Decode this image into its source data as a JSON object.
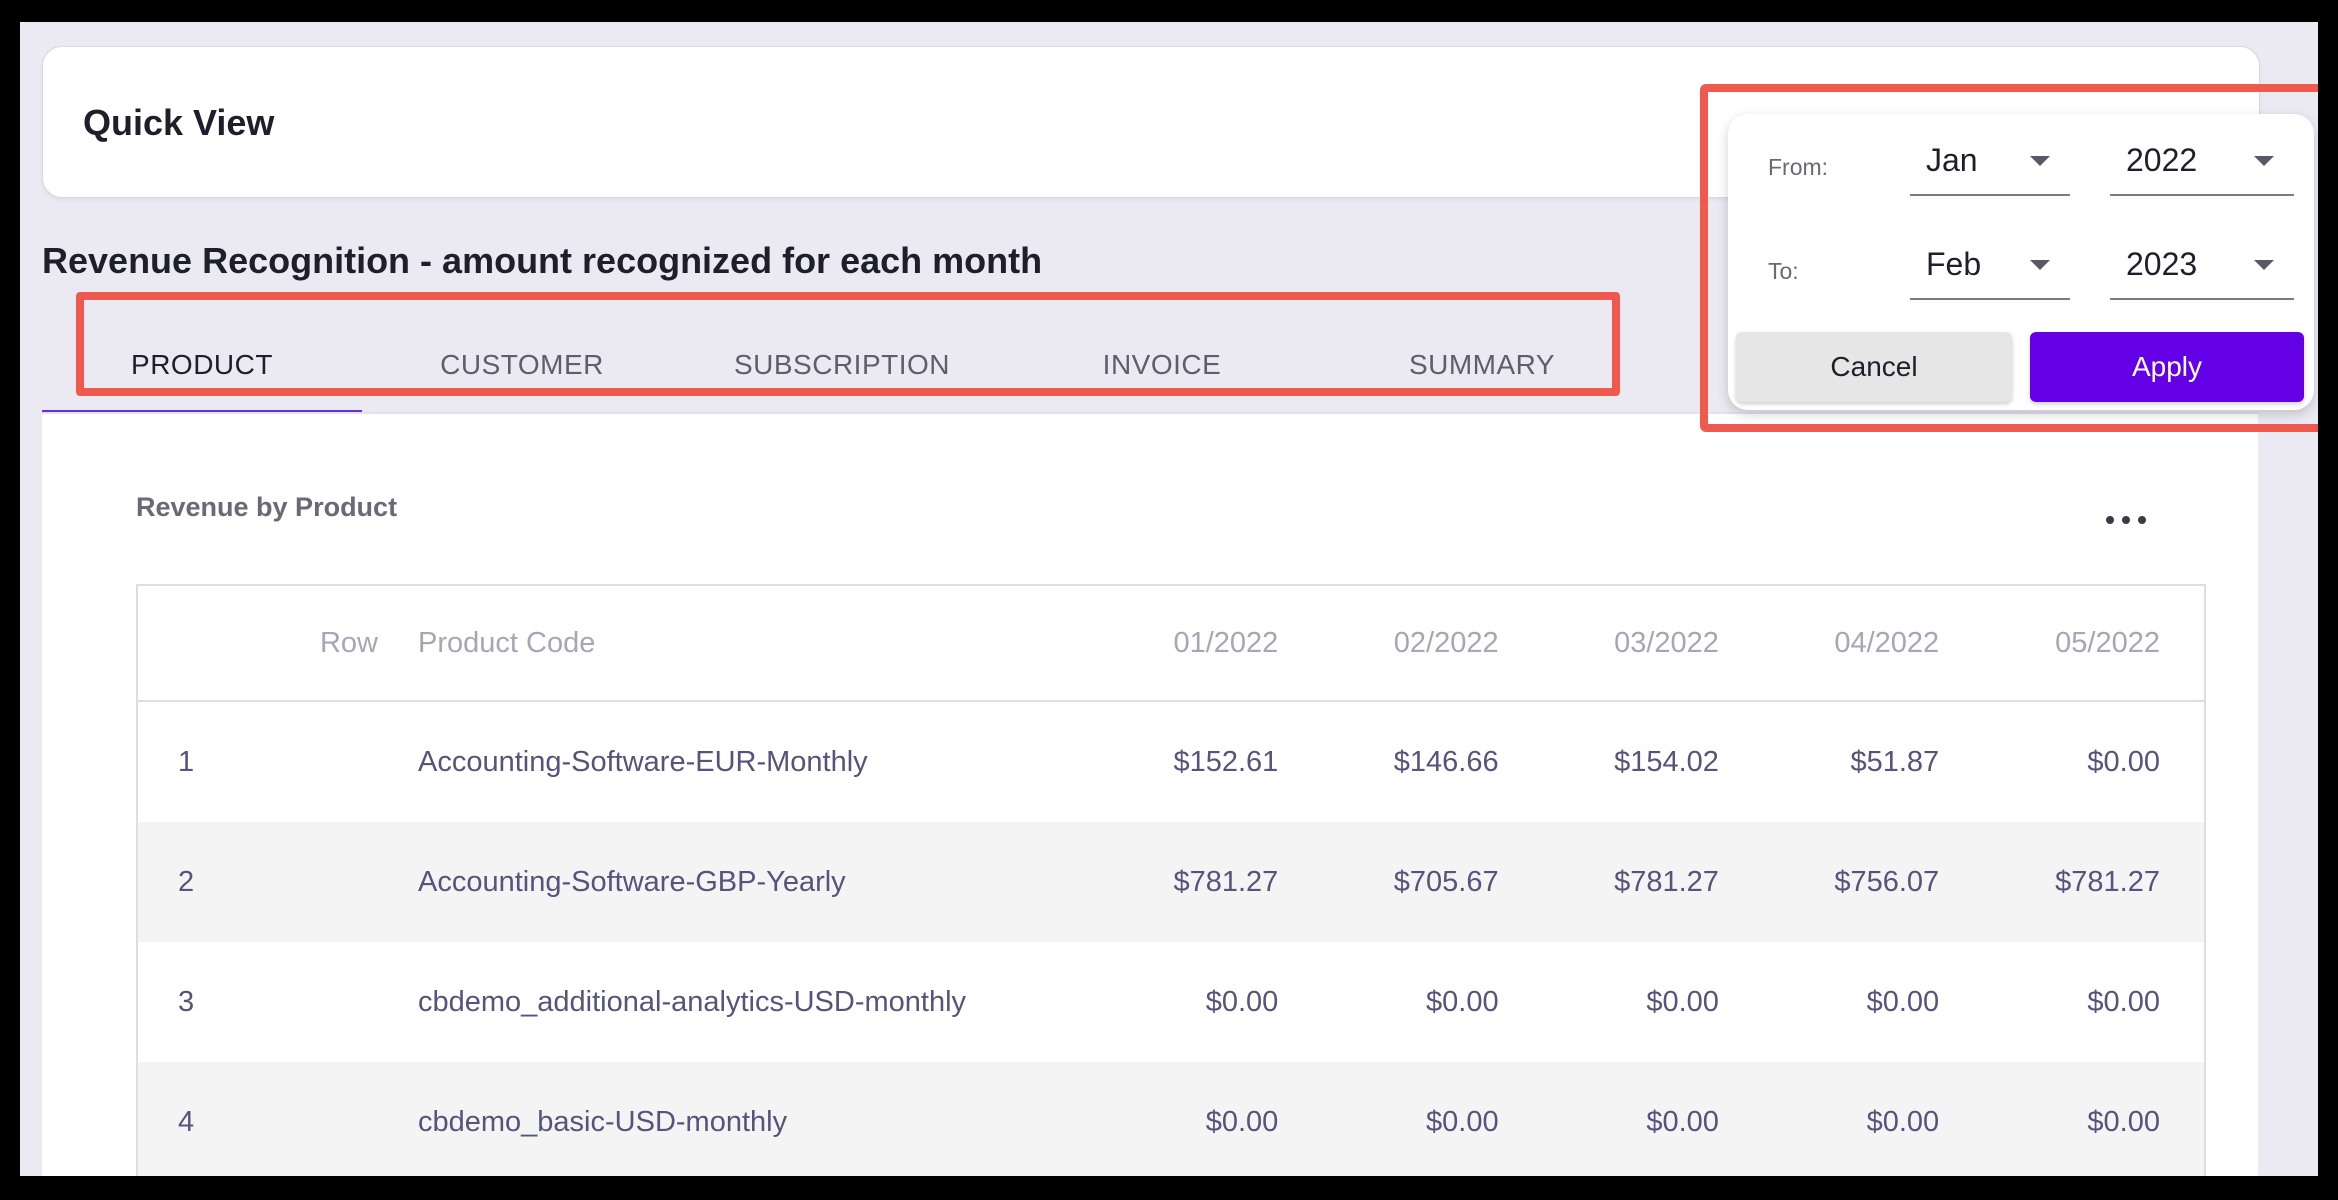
{
  "quick_view": {
    "title": "Quick View"
  },
  "section": {
    "title": "Revenue Recognition - amount recognized for each month"
  },
  "tabs": [
    {
      "label": "PRODUCT",
      "active": true
    },
    {
      "label": "CUSTOMER",
      "active": false
    },
    {
      "label": "SUBSCRIPTION",
      "active": false
    },
    {
      "label": "INVOICE",
      "active": false
    },
    {
      "label": "SUMMARY",
      "active": false
    }
  ],
  "card": {
    "title": "Revenue by Product",
    "more_icon": "more-horizontal-icon"
  },
  "table": {
    "headers": [
      "Row",
      "Product Code",
      "01/2022",
      "02/2022",
      "03/2022",
      "04/2022",
      "05/2022"
    ],
    "rows": [
      [
        "1",
        "Accounting-Software-EUR-Monthly",
        "$152.61",
        "$146.66",
        "$154.02",
        "$51.87",
        "$0.00"
      ],
      [
        "2",
        "Accounting-Software-GBP-Yearly",
        "$781.27",
        "$705.67",
        "$781.27",
        "$756.07",
        "$781.27"
      ],
      [
        "3",
        "cbdemo_additional-analytics-USD-monthly",
        "$0.00",
        "$0.00",
        "$0.00",
        "$0.00",
        "$0.00"
      ],
      [
        "4",
        "cbdemo_basic-USD-monthly",
        "$0.00",
        "$0.00",
        "$0.00",
        "$0.00",
        "$0.00"
      ]
    ]
  },
  "date_picker": {
    "from_label": "From:",
    "to_label": "To:",
    "from_month": "Jan",
    "from_year": "2022",
    "to_month": "Feb",
    "to_year": "2023",
    "cancel_label": "Cancel",
    "apply_label": "Apply"
  },
  "colors": {
    "accent": "#6b2cd8",
    "apply": "#6400e6",
    "highlight": "#f05a4e"
  }
}
